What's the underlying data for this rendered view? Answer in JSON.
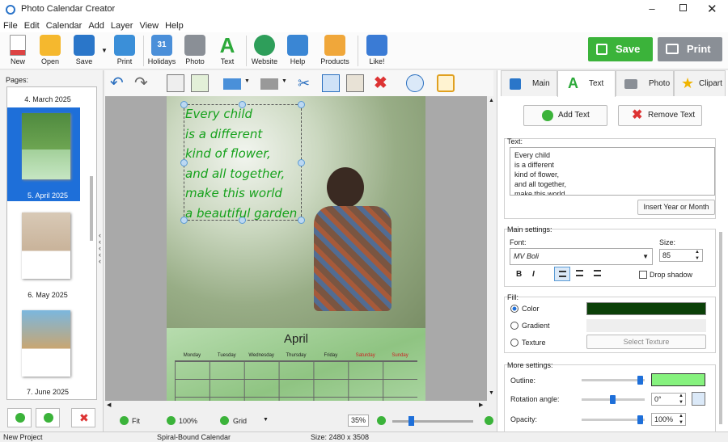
{
  "window": {
    "title": "Photo Calendar Creator"
  },
  "menu": [
    "File",
    "Edit",
    "Calendar",
    "Add",
    "Layer",
    "View",
    "Help"
  ],
  "toolbar": {
    "new": "New",
    "open": "Open",
    "save": "Save",
    "print": "Print",
    "holidays": "Holidays",
    "photo": "Photo",
    "text": "Text",
    "website": "Website",
    "help": "Help",
    "products": "Products",
    "like": "Like!",
    "save_big": "Save",
    "print_big": "Print"
  },
  "pages": {
    "label": "Pages:",
    "items": [
      "4. March 2025",
      "5. April 2025",
      "6. May 2025",
      "7. June 2025"
    ],
    "selected": "5. April 2025"
  },
  "canvas": {
    "text_lines": [
      "Every child",
      "is a different",
      "kind of flower,",
      "and all together,",
      "make this world",
      "a beautiful garden"
    ],
    "month": "April",
    "weekdays": [
      "Monday",
      "Tuesday",
      "Wednesday",
      "Thursday",
      "Friday",
      "Saturday",
      "Sunday"
    ]
  },
  "bottom": {
    "fit": "Fit",
    "zoom100": "100%",
    "grid": "Grid",
    "zoom_value": "35%"
  },
  "status": {
    "project": "New Project",
    "type": "Spiral-Bound Calendar",
    "size": "Size: 2480 x 3508"
  },
  "panel": {
    "tabs": [
      "Main",
      "Text",
      "Photo",
      "Clipart"
    ],
    "active_tab": "Text",
    "add_text": "Add Text",
    "remove_text": "Remove Text",
    "text_label": "Text:",
    "text_value": "Every child\nis a different\nkind of flower,\nand all together,\nmake this world",
    "insert_year": "Insert Year or Month",
    "main_settings": "Main settings:",
    "font_label": "Font:",
    "font_value": "MV Boli",
    "size_label": "Size:",
    "size_value": "85",
    "bold": "B",
    "italic": "I",
    "drop_shadow": "Drop shadow",
    "fill_label": "Fill:",
    "fill_color": "Color",
    "fill_gradient": "Gradient",
    "fill_texture": "Texture",
    "select_texture": "Select Texture",
    "color_value": "#0b4008",
    "more_settings": "More settings:",
    "outline": "Outline:",
    "outline_color": "#86f27e",
    "rotation": "Rotation angle:",
    "rotation_value": "0°",
    "opacity": "Opacity:",
    "opacity_value": "100%"
  }
}
